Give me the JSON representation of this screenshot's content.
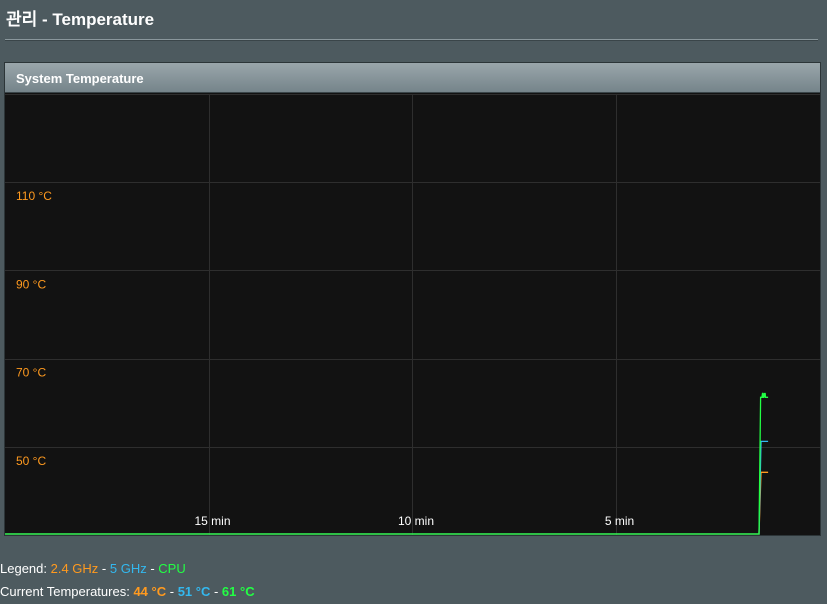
{
  "page": {
    "title": "관리 - Temperature"
  },
  "panel": {
    "title": "System Temperature"
  },
  "colors": {
    "ghz24": "#ff9a1f",
    "ghz5": "#33b8ef",
    "cpu": "#22ff44",
    "grid": "#2e2e2e",
    "y_label": "#ff9a1f",
    "x_label": "#ffffff"
  },
  "chart_data": {
    "type": "line",
    "y_ticks": [
      "110 °C",
      "90 °C",
      "70 °C",
      "50 °C"
    ],
    "x_ticks": [
      "15 min",
      "10 min",
      "5 min"
    ],
    "ylim": [
      30,
      130
    ],
    "grid": true,
    "series": [
      {
        "name": "2.4 GHz",
        "points": [
          [
            0.0,
            30
          ],
          [
            0.5,
            30
          ],
          [
            0.65,
            44
          ],
          [
            1.2,
            44
          ]
        ]
      },
      {
        "name": "5 GHz",
        "points": [
          [
            0.0,
            30
          ],
          [
            0.5,
            30
          ],
          [
            0.65,
            51
          ],
          [
            1.2,
            51
          ]
        ]
      },
      {
        "name": "CPU",
        "points": [
          [
            0.0,
            30
          ],
          [
            0.5,
            30
          ],
          [
            0.62,
            61
          ],
          [
            0.72,
            61
          ],
          [
            0.78,
            62
          ],
          [
            0.82,
            61
          ],
          [
            0.86,
            61
          ],
          [
            0.9,
            62
          ],
          [
            0.93,
            61
          ],
          [
            0.97,
            62
          ],
          [
            1.0,
            61
          ],
          [
            1.2,
            61
          ]
        ]
      }
    ]
  },
  "legend": {
    "label": "Legend:",
    "ghz24": "2.4 GHz",
    "sep1": " - ",
    "ghz5": "5 GHz",
    "sep2": " - ",
    "cpu": "CPU"
  },
  "current": {
    "label": "Current Temperatures:",
    "ghz24": "44 °C",
    "sep1": " - ",
    "ghz5": "51 °C",
    "sep2": " - ",
    "cpu": "61 °C"
  }
}
